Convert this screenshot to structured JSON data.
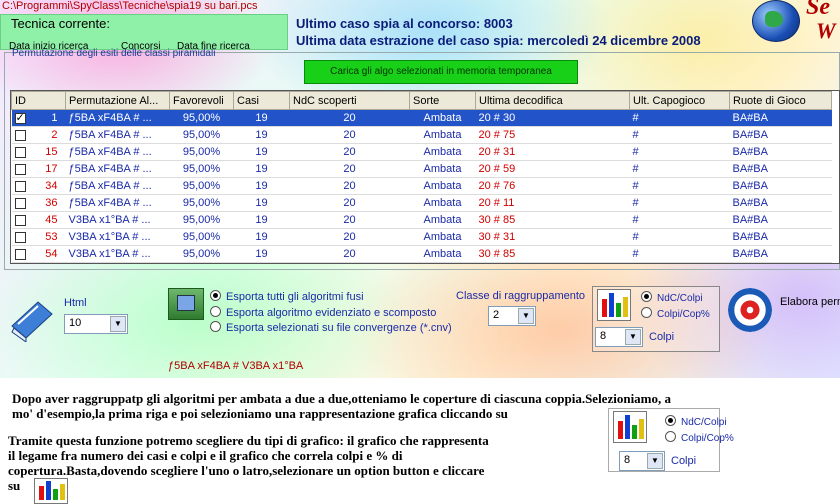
{
  "path": "C:\\Programmi\\SpyClass\\Tecniche\\spia19 su bari.pcs",
  "tecnica": {
    "title": "Tecnica corrente:",
    "sub1": "Data inizio ricerca",
    "sub2": "Concorsi",
    "sub3": "Data fine ricerca"
  },
  "info": {
    "line1": "Ultimo caso spia al concorso:  8003",
    "line2": "Ultima data estrazione del caso spia:  mercoledì 24 dicembre 2008"
  },
  "logo": {
    "line1": "Se",
    "line2": "W"
  },
  "group_label": "Permutazione degli esiti delle classi piramidali",
  "load_button": "Carica gli algo selezionati in memoria temporanea",
  "grid": {
    "columns": [
      "ID",
      "Permutazione Al...",
      "Favorevoli",
      "Casi",
      "NdC scoperti",
      "Sorte",
      "Ultima decodifica",
      "Ult. Capogioco",
      "Ruote di Gioco"
    ],
    "rows": [
      {
        "checked": true,
        "id": "1",
        "perm": "ƒ5BA xF4BA # ...",
        "fav": "95,00%",
        "casi": "19",
        "ndc": "20",
        "sorte": "Ambata",
        "ult": "20 # 30",
        "capo": "#",
        "ruote": "BA#BA"
      },
      {
        "checked": false,
        "id": "2",
        "perm": "ƒ5BA xF4BA # ...",
        "fav": "95,00%",
        "casi": "19",
        "ndc": "20",
        "sorte": "Ambata",
        "ult": "20 # 75",
        "capo": "#",
        "ruote": "BA#BA"
      },
      {
        "checked": false,
        "id": "15",
        "perm": "ƒ5BA xF4BA # ...",
        "fav": "95,00%",
        "casi": "19",
        "ndc": "20",
        "sorte": "Ambata",
        "ult": "20 # 31",
        "capo": "#",
        "ruote": "BA#BA"
      },
      {
        "checked": false,
        "id": "17",
        "perm": "ƒ5BA xF4BA # ...",
        "fav": "95,00%",
        "casi": "19",
        "ndc": "20",
        "sorte": "Ambata",
        "ult": "20 # 59",
        "capo": "#",
        "ruote": "BA#BA"
      },
      {
        "checked": false,
        "id": "34",
        "perm": "ƒ5BA xF4BA # ...",
        "fav": "95,00%",
        "casi": "19",
        "ndc": "20",
        "sorte": "Ambata",
        "ult": "20 # 76",
        "capo": "#",
        "ruote": "BA#BA"
      },
      {
        "checked": false,
        "id": "36",
        "perm": "ƒ5BA xF4BA # ...",
        "fav": "95,00%",
        "casi": "19",
        "ndc": "20",
        "sorte": "Ambata",
        "ult": "20 # 11",
        "capo": "#",
        "ruote": "BA#BA"
      },
      {
        "checked": false,
        "id": "45",
        "perm": "V3BA x1°BA # ...",
        "fav": "95,00%",
        "casi": "19",
        "ndc": "20",
        "sorte": "Ambata",
        "ult": "30 # 85",
        "capo": "#",
        "ruote": "BA#BA"
      },
      {
        "checked": false,
        "id": "53",
        "perm": "V3BA x1°BA # ...",
        "fav": "95,00%",
        "casi": "19",
        "ndc": "20",
        "sorte": "Ambata",
        "ult": "30 # 31",
        "capo": "#",
        "ruote": "BA#BA"
      },
      {
        "checked": false,
        "id": "54",
        "perm": "V3BA x1°BA # ...",
        "fav": "95,00%",
        "casi": "19",
        "ndc": "20",
        "sorte": "Ambata",
        "ult": "30 # 85",
        "capo": "#",
        "ruote": "BA#BA"
      }
    ]
  },
  "html": {
    "label": "Html",
    "value": "10"
  },
  "export": {
    "opt1": "Esporta tutti gli algoritmi fusi",
    "opt2": "Esporta algoritmo evidenziato e scomposto",
    "opt3": "Esporta selezionati su file convergenze (*.cnv)"
  },
  "classe": {
    "label": "Classe di raggruppamento",
    "value": "2"
  },
  "graph": {
    "opt1": "NdC/Colpi",
    "opt2": "Colpi/Cop%",
    "value": "8",
    "colpi": "Colpi"
  },
  "elabora": "Elabora perm",
  "formula": "ƒ5BA xF4BA # V3BA x1°BA",
  "paragraph1": {
    "l1": "Dopo aver raggruppatp gli algoritmi per ambata a due a due,otteniamo le coperture di ciascuna coppia.Selezioniamo, a",
    "l2": "mo' d'esempio,la prima riga e  poi selezioniamo una rappresentazione grafica cliccando su"
  },
  "paragraph2": {
    "l1": "Tramite questa funzione potremo scegliere du tipi di grafico: il grafico che rappresenta",
    "l2": "il legame fra numero dei casi e colpi e il grafico che correla colpi e % di",
    "l3": "copertura.Basta,dovendo scegliere l'uno o latro,selezionare un option button e cliccare",
    "l4": "su"
  },
  "colors": {
    "selection": "#2353c8",
    "load_button": "#18d018",
    "id_red": "#d00000",
    "text_blue": "#1a2aa8"
  }
}
